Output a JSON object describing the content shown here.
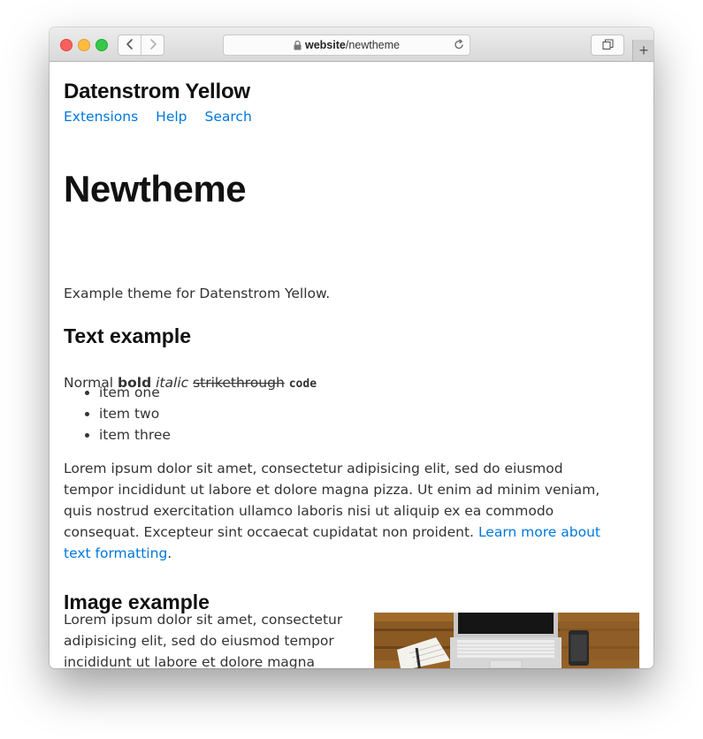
{
  "browser": {
    "address_host": "website",
    "address_path": "/newtheme",
    "new_tab_label": "+"
  },
  "site": {
    "title": "Datenstrom Yellow",
    "nav": [
      "Extensions",
      "Help",
      "Search"
    ]
  },
  "page": {
    "title": "Newtheme",
    "intro": "Example theme for Datenstrom Yellow.",
    "text_heading": "Text example",
    "format_normal": "Normal",
    "format_bold": "bold",
    "format_italic": "italic",
    "format_strike": "strikethrough",
    "format_code": "code",
    "list": [
      "item one",
      "item two",
      "item three"
    ],
    "lorem": "Lorem ipsum dolor sit amet, consectetur adipisicing elit, sed do eiusmod tempor incididunt ut labore et dolore magna pizza. Ut enim ad minim veniam, quis nostrud exercitation ullamco laboris nisi ut aliquip ex ea commodo consequat. Excepteur sint occaecat cupidatat non proident.",
    "lorem_link": "Learn more about text formatting",
    "lorem_end": ".",
    "image_heading": "Image example",
    "image_text": "Lorem ipsum dolor sit amet, consectetur adipisicing elit, sed do eiusmod tempor incididunt ut labore et dolore magna pizza. Ut"
  },
  "colors": {
    "link": "#0077dd",
    "heading": "#111111",
    "text": "#333333"
  },
  "icons": {
    "back": "chevron-left-icon",
    "forward": "chevron-right-icon",
    "lock": "lock-icon",
    "reload": "reload-icon",
    "tabs": "tab-overview-icon"
  }
}
